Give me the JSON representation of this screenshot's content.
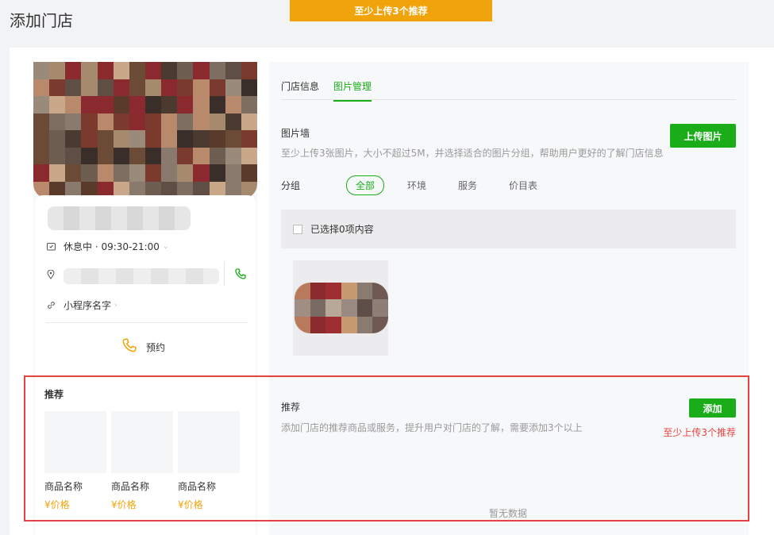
{
  "page_title": "添加门店",
  "top_banner": "至少上传3个推荐",
  "store": {
    "hours": "休息中 · 09:30-21:00",
    "mini_program": "小程序名字",
    "book_label": "预约"
  },
  "recommend_preview": {
    "title": "推荐",
    "goods": [
      {
        "name": "商品名称",
        "price": "¥价格"
      },
      {
        "name": "商品名称",
        "price": "¥价格"
      },
      {
        "name": "商品名称",
        "price": "¥价格"
      }
    ]
  },
  "tabs": [
    {
      "label": "门店信息",
      "active": false
    },
    {
      "label": "图片管理",
      "active": true
    }
  ],
  "photo_wall": {
    "title": "图片墙",
    "description": "至少上传3张图片，大小不超过5M，并选择适合的图片分组，帮助用户更好的了解门店信息",
    "upload_button": "上传图片",
    "group_label": "分组",
    "groups": [
      {
        "label": "全部",
        "active": true
      },
      {
        "label": "环境",
        "active": false
      },
      {
        "label": "服务",
        "active": false
      },
      {
        "label": "价目表",
        "active": false
      }
    ],
    "selected_text": "已选择0项内容"
  },
  "recommend": {
    "title": "推荐",
    "description": "添加门店的推荐商品或服务，提升用户对门店的了解，需要添加3个以上",
    "add_button": "添加",
    "warning": "至少上传3个推荐",
    "empty": "暂无数据"
  },
  "colors": {
    "primary_green": "#1aad19",
    "warning_orange": "#f0a30a",
    "error_red": "#e64340"
  }
}
